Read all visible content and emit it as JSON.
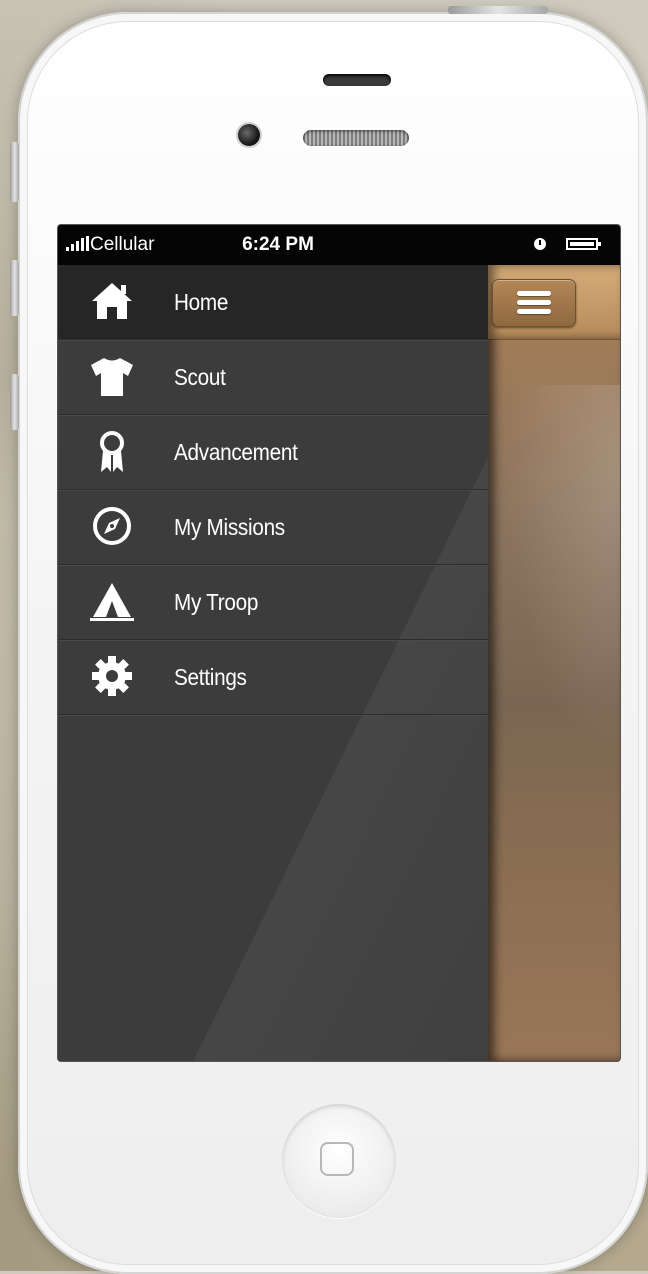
{
  "status_bar": {
    "carrier": "Cellular",
    "time": "6:24 PM"
  },
  "menu": {
    "items": [
      {
        "label": "Home",
        "icon": "home-icon",
        "active": true
      },
      {
        "label": "Scout",
        "icon": "shirt-icon",
        "active": false
      },
      {
        "label": "Advancement",
        "icon": "ribbon-award-icon",
        "active": false
      },
      {
        "label": "My Missions",
        "icon": "compass-icon",
        "active": false
      },
      {
        "label": "My Troop",
        "icon": "tent-icon",
        "active": false
      },
      {
        "label": "Settings",
        "icon": "gear-icon",
        "active": false
      }
    ]
  },
  "content": {
    "menu_button_icon": "hamburger-menu-icon",
    "header_color": "#c99e6b"
  },
  "colors": {
    "drawer_bg": "#3c3c3c",
    "active_item_bg": "#262626",
    "status_bar_bg": "#050505",
    "text": "#ffffff"
  }
}
